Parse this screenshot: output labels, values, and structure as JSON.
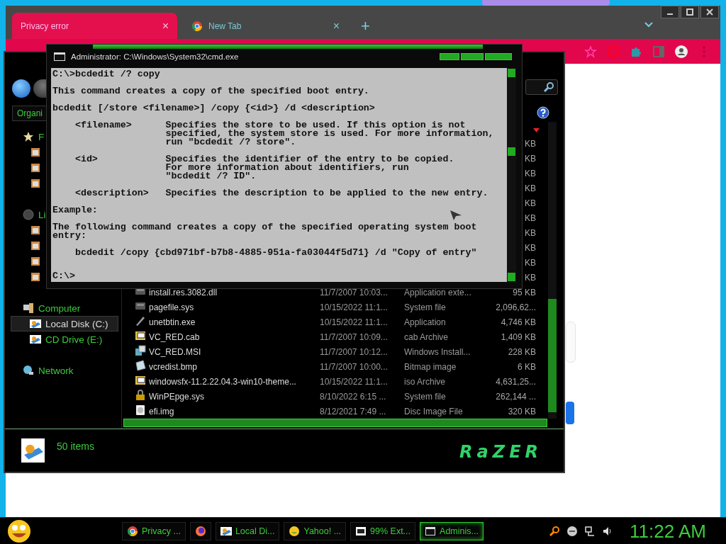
{
  "browser": {
    "tabs": [
      {
        "label": "Privacy error",
        "selected": true,
        "close": "×"
      },
      {
        "label": "New Tab",
        "selected": false,
        "close": "×"
      }
    ],
    "new_tab": "+"
  },
  "explorer": {
    "toolbar_label": "Organi",
    "nav": [
      {
        "label": "F",
        "kind": "favorites",
        "children": [
          {
            "selected": false
          },
          {
            "selected": false
          },
          {
            "selected": false
          }
        ]
      },
      {
        "label": "Li",
        "kind": "libraries",
        "children": [
          {
            "selected": false
          },
          {
            "selected": false
          },
          {
            "selected": false
          },
          {
            "selected": false
          }
        ]
      },
      {
        "label": "Computer",
        "kind": "computer",
        "children": [
          {
            "label": "Local Disk (C:)",
            "selected": true
          },
          {
            "label": "CD Drive (E:)",
            "selected": false
          }
        ]
      },
      {
        "label": "Network",
        "kind": "network"
      }
    ],
    "files": [
      {
        "size": "KB"
      },
      {
        "size": "KB"
      },
      {
        "size": "KB"
      },
      {
        "size": "KB"
      },
      {
        "size": "KB"
      },
      {
        "size": "KB"
      },
      {
        "size": "KB"
      },
      {
        "size": "KB"
      },
      {
        "size": "KB"
      },
      {
        "size": "KB"
      },
      {
        "name": "install.res.3082.dll",
        "date": "11/7/2007 10:03...",
        "type": "Application exte...",
        "size": "95 KB",
        "kind": "dll"
      },
      {
        "name": "pagefile.sys",
        "date": "10/15/2022 11:1...",
        "type": "System file",
        "size": "2,096,62...",
        "kind": "sys"
      },
      {
        "name": "unetbtin.exe",
        "date": "10/15/2022 11:1...",
        "type": "Application",
        "size": "4,746 KB",
        "kind": "exe"
      },
      {
        "name": "VC_RED.cab",
        "date": "11/7/2007 10:09...",
        "type": "cab Archive",
        "size": "1,409 KB",
        "kind": "cab"
      },
      {
        "name": "VC_RED.MSI",
        "date": "11/7/2007 10:12...",
        "type": "Windows Install...",
        "size": "228 KB",
        "kind": "msi"
      },
      {
        "name": "vcredist.bmp",
        "date": "11/7/2007 10:00...",
        "type": "Bitmap image",
        "size": "6 KB",
        "kind": "bmp"
      },
      {
        "name": "windowsfx-11.2.22.04.3-win10-theme...",
        "date": "10/15/2022 11:1...",
        "type": "iso Archive",
        "size": "4,631,25...",
        "kind": "iso"
      },
      {
        "name": "WinPEpge.sys",
        "date": "8/10/2022 6:15 ...",
        "type": "System file",
        "size": "262,144 ...",
        "kind": "lock"
      },
      {
        "name": "efi.img",
        "date": "8/12/2021 7:49 ...",
        "type": "Disc Image File",
        "size": "320 KB",
        "kind": "img"
      }
    ],
    "status": "50 items",
    "logo": "RaZER"
  },
  "console": {
    "title": "Administrator: C:\\Windows\\System32\\cmd.exe",
    "blocks": [
      "C:\\>bcdedit /? copy",
      "This command creates a copy of the specified boot entry.",
      "bcdedit [/store <filename>] /copy {<id>} /d <description>",
      "    <filename>      Specifies the store to be used. If this option is not\n                    specified, the system store is used. For more information,\n                    run \"bcdedit /? store\".",
      "    <id>            Specifies the identifier of the entry to be copied.\n                    For more information about identifiers, run\n                    \"bcdedit /? ID\".",
      "    <description>   Specifies the description to be applied to the new entry.",
      "Example:",
      "The following command creates a copy of the specified operating system boot\nentry:",
      "    bcdedit /copy {cbd971bf-b7b8-4885-951a-fa03044f5d71} /d \"Copy of entry\""
    ],
    "prompt": "C:\\>"
  },
  "taskbar": {
    "items": [
      {
        "label": "Privacy ...",
        "kind": "chrome",
        "selected": false
      },
      {
        "kind": "firefox",
        "selected": false
      },
      {
        "label": "Local Di...",
        "kind": "drive",
        "selected": false
      },
      {
        "label": "Yahoo! ...",
        "kind": "smiley",
        "selected": false
      },
      {
        "label": "99% Ext...",
        "kind": "archive",
        "selected": false
      },
      {
        "label": "Adminis...",
        "kind": "console",
        "selected": true
      }
    ],
    "clock": "11:22 AM"
  }
}
